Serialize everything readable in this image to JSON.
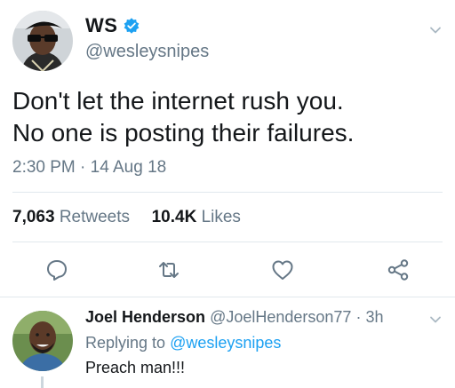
{
  "tweet": {
    "author_name": "WS",
    "author_handle": "@wesleysnipes",
    "verified": true,
    "text_lines": [
      "Don't let the internet rush you.",
      "No one is posting their failures."
    ],
    "timestamp": "2:30 PM · 14 Aug 18",
    "retweets_count": "7,063",
    "retweets_label": "Retweets",
    "likes_count": "10.4K",
    "likes_label": "Likes"
  },
  "actions": {
    "reply_icon": "reply-icon",
    "retweet_icon": "retweet-icon",
    "like_icon": "heart-icon",
    "share_icon": "share-icon"
  },
  "reply": {
    "author_name": "Joel Henderson",
    "author_handle": "@JoelHenderson77",
    "time": "3h",
    "replying_to_label": "Replying to",
    "replying_to_handle": "@wesleysnipes",
    "text": "Preach man!!!"
  },
  "colors": {
    "accent": "#1da1f2",
    "secondary_text": "#657786",
    "primary_text": "#14171a",
    "divider": "#e1e8ed"
  }
}
